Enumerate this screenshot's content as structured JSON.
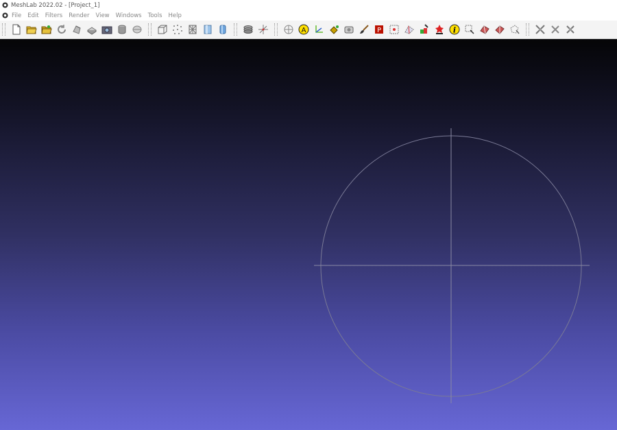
{
  "window": {
    "title": "MeshLab 2022.02 - [Project_1]"
  },
  "menubar": {
    "items": [
      {
        "label": "File"
      },
      {
        "label": "Edit"
      },
      {
        "label": "Filters"
      },
      {
        "label": "Render"
      },
      {
        "label": "View"
      },
      {
        "label": "Windows"
      },
      {
        "label": "Tools"
      },
      {
        "label": "Help"
      }
    ]
  },
  "toolbar": {
    "file_group": [
      "new-project-icon",
      "open-project-icon",
      "open-mesh-icon",
      "reload-icon",
      "reload-all-icon",
      "save-mesh-icon",
      "snapshot-icon",
      "save-layers-icon",
      "close-mesh-icon"
    ],
    "render_group": [
      "bounding-box-icon",
      "points-icon",
      "wireframe-icon",
      "flat-shading-icon",
      "smooth-shading-icon"
    ],
    "layers_group": [
      "layer-dialog-icon",
      "decoration-axes-icon"
    ],
    "edit_group": [
      "trackball-icon",
      "annotate-icon",
      "measure-icon",
      "paint-bucket-icon",
      "camera-icon",
      "brush-icon",
      "texture-paint-icon",
      "select-vertices-icon",
      "select-faces-icon",
      "color-paint-icon",
      "geometry-paint-icon",
      "info-icon",
      "connected-select-icon",
      "align-icon",
      "manipulator-icon",
      "select-region-icon"
    ],
    "filter_group": [
      "apply-filter-icon",
      "repeat-filter-icon",
      "last-filter-icon"
    ]
  },
  "colors": {
    "viewport_top": "#050507",
    "viewport_bottom": "#6767d5",
    "trackball": "#7a7a96"
  }
}
